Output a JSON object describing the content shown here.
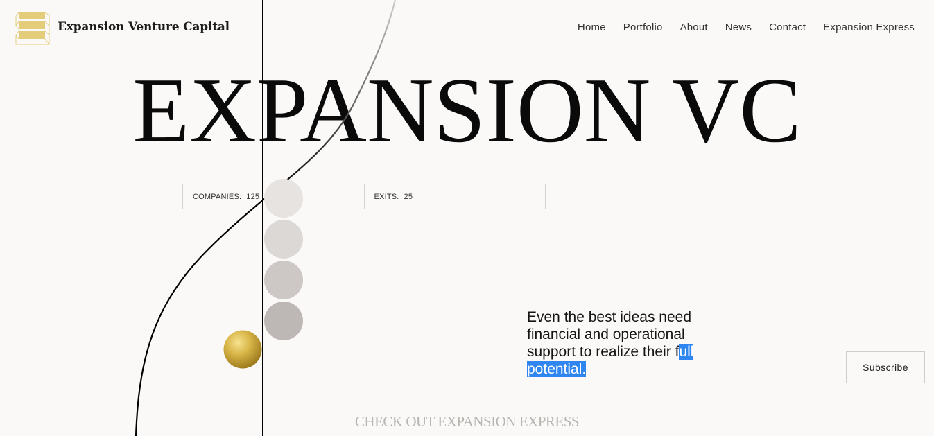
{
  "header": {
    "brand_name": "Expansion Venture Capital",
    "logo_icon": "stacked-bars-logo-icon",
    "nav": [
      {
        "label": "Home",
        "active": true
      },
      {
        "label": "Portfolio",
        "active": false
      },
      {
        "label": "About",
        "active": false
      },
      {
        "label": "News",
        "active": false
      },
      {
        "label": "Contact",
        "active": false
      },
      {
        "label": "Expansion Express",
        "active": false
      }
    ]
  },
  "hero": {
    "title": "EXPANSION VC"
  },
  "stats": {
    "companies_label": "COMPANIES:",
    "companies_value": "125",
    "exits_label": "EXITS:",
    "exits_value": "25"
  },
  "tagline": {
    "text_plain": "Even the best ideas need financial and operational support to realize their f",
    "text_selected": "ull potential."
  },
  "subscribe": {
    "label": "Subscribe"
  },
  "express_link": {
    "label": "CHECK OUT EXPANSION EXPRESS"
  },
  "colors": {
    "background": "#faf9f8",
    "logo_gold": "#e3cd7b",
    "selection_blue": "#2f86f0",
    "gold_sphere": "#d7b443",
    "muted_link": "#b9b5b1"
  }
}
